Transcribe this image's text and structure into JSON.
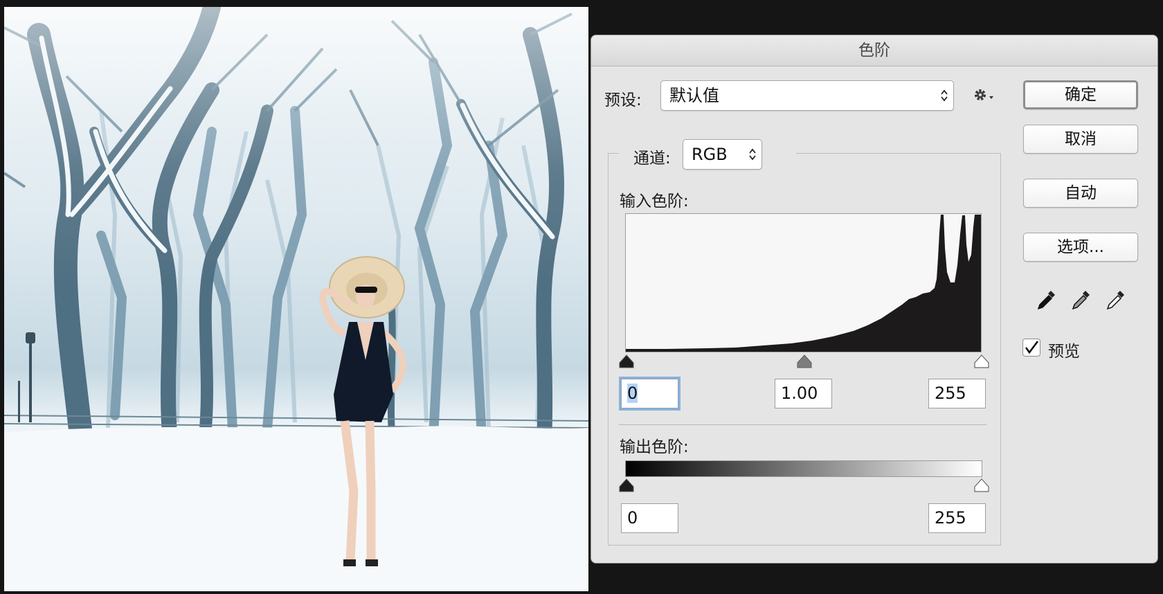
{
  "dialog": {
    "title": "色阶",
    "preset_label": "预设:",
    "preset_value": "默认值",
    "channel_label": "通道:",
    "channel_value": "RGB",
    "input_levels_label": "输入色阶:",
    "output_levels_label": "输出色阶:",
    "input_black": "0",
    "input_gamma": "1.00",
    "input_white": "255",
    "output_black": "0",
    "output_white": "255",
    "buttons": {
      "ok": "确定",
      "cancel": "取消",
      "auto": "自动",
      "options": "选项..."
    },
    "preview_label": "预览",
    "preview_checked": true
  },
  "icons": [
    "gear-icon",
    "black-eyedropper-icon",
    "gray-eyedropper-icon",
    "white-eyedropper-icon",
    "checkmark-icon",
    "chevron-updown-icon"
  ],
  "colors": {
    "dialog_bg": "#e5e5e5",
    "focus_ring": "#86b2e3",
    "histogram_fill": "#1d1a1b"
  }
}
